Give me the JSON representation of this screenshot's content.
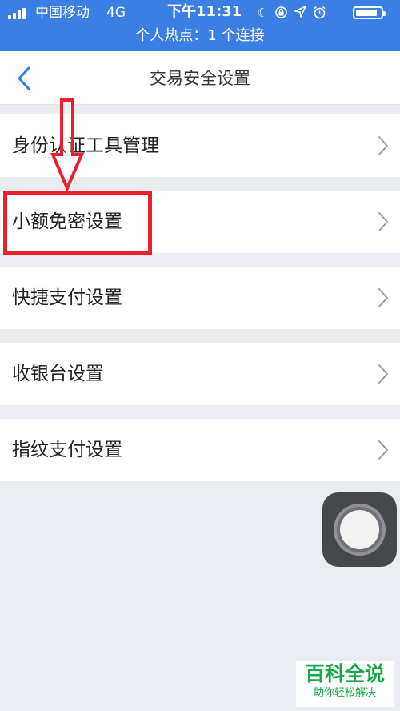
{
  "status_bar": {
    "carrier": "中国移动",
    "network": "4G",
    "time": "下午11:31",
    "hotspot_text": "个人热点：1 个连接",
    "battery_level": 0.85,
    "icons": [
      "moon-icon",
      "rotation-lock-icon",
      "location-icon",
      "alarm-icon"
    ],
    "background_color": "#3a7fe3"
  },
  "nav": {
    "title": "交易安全设置",
    "back_icon": "chevron-left-icon",
    "back_color": "#2f7ee6"
  },
  "menu": {
    "items": [
      {
        "label": "身份认证工具管理"
      },
      {
        "label": "小额免密设置"
      },
      {
        "label": "快捷支付设置"
      },
      {
        "label": "收银台设置"
      },
      {
        "label": "指纹支付设置"
      }
    ],
    "chevron_icon": "chevron-right-icon"
  },
  "annotation": {
    "arrow_icon": "down-arrow-icon",
    "highlight_target": "小额免密设置",
    "color": "#e8212c"
  },
  "watermark": {
    "main": "百科全说",
    "sub": "助你轻松解决",
    "color": "#18a84a"
  }
}
